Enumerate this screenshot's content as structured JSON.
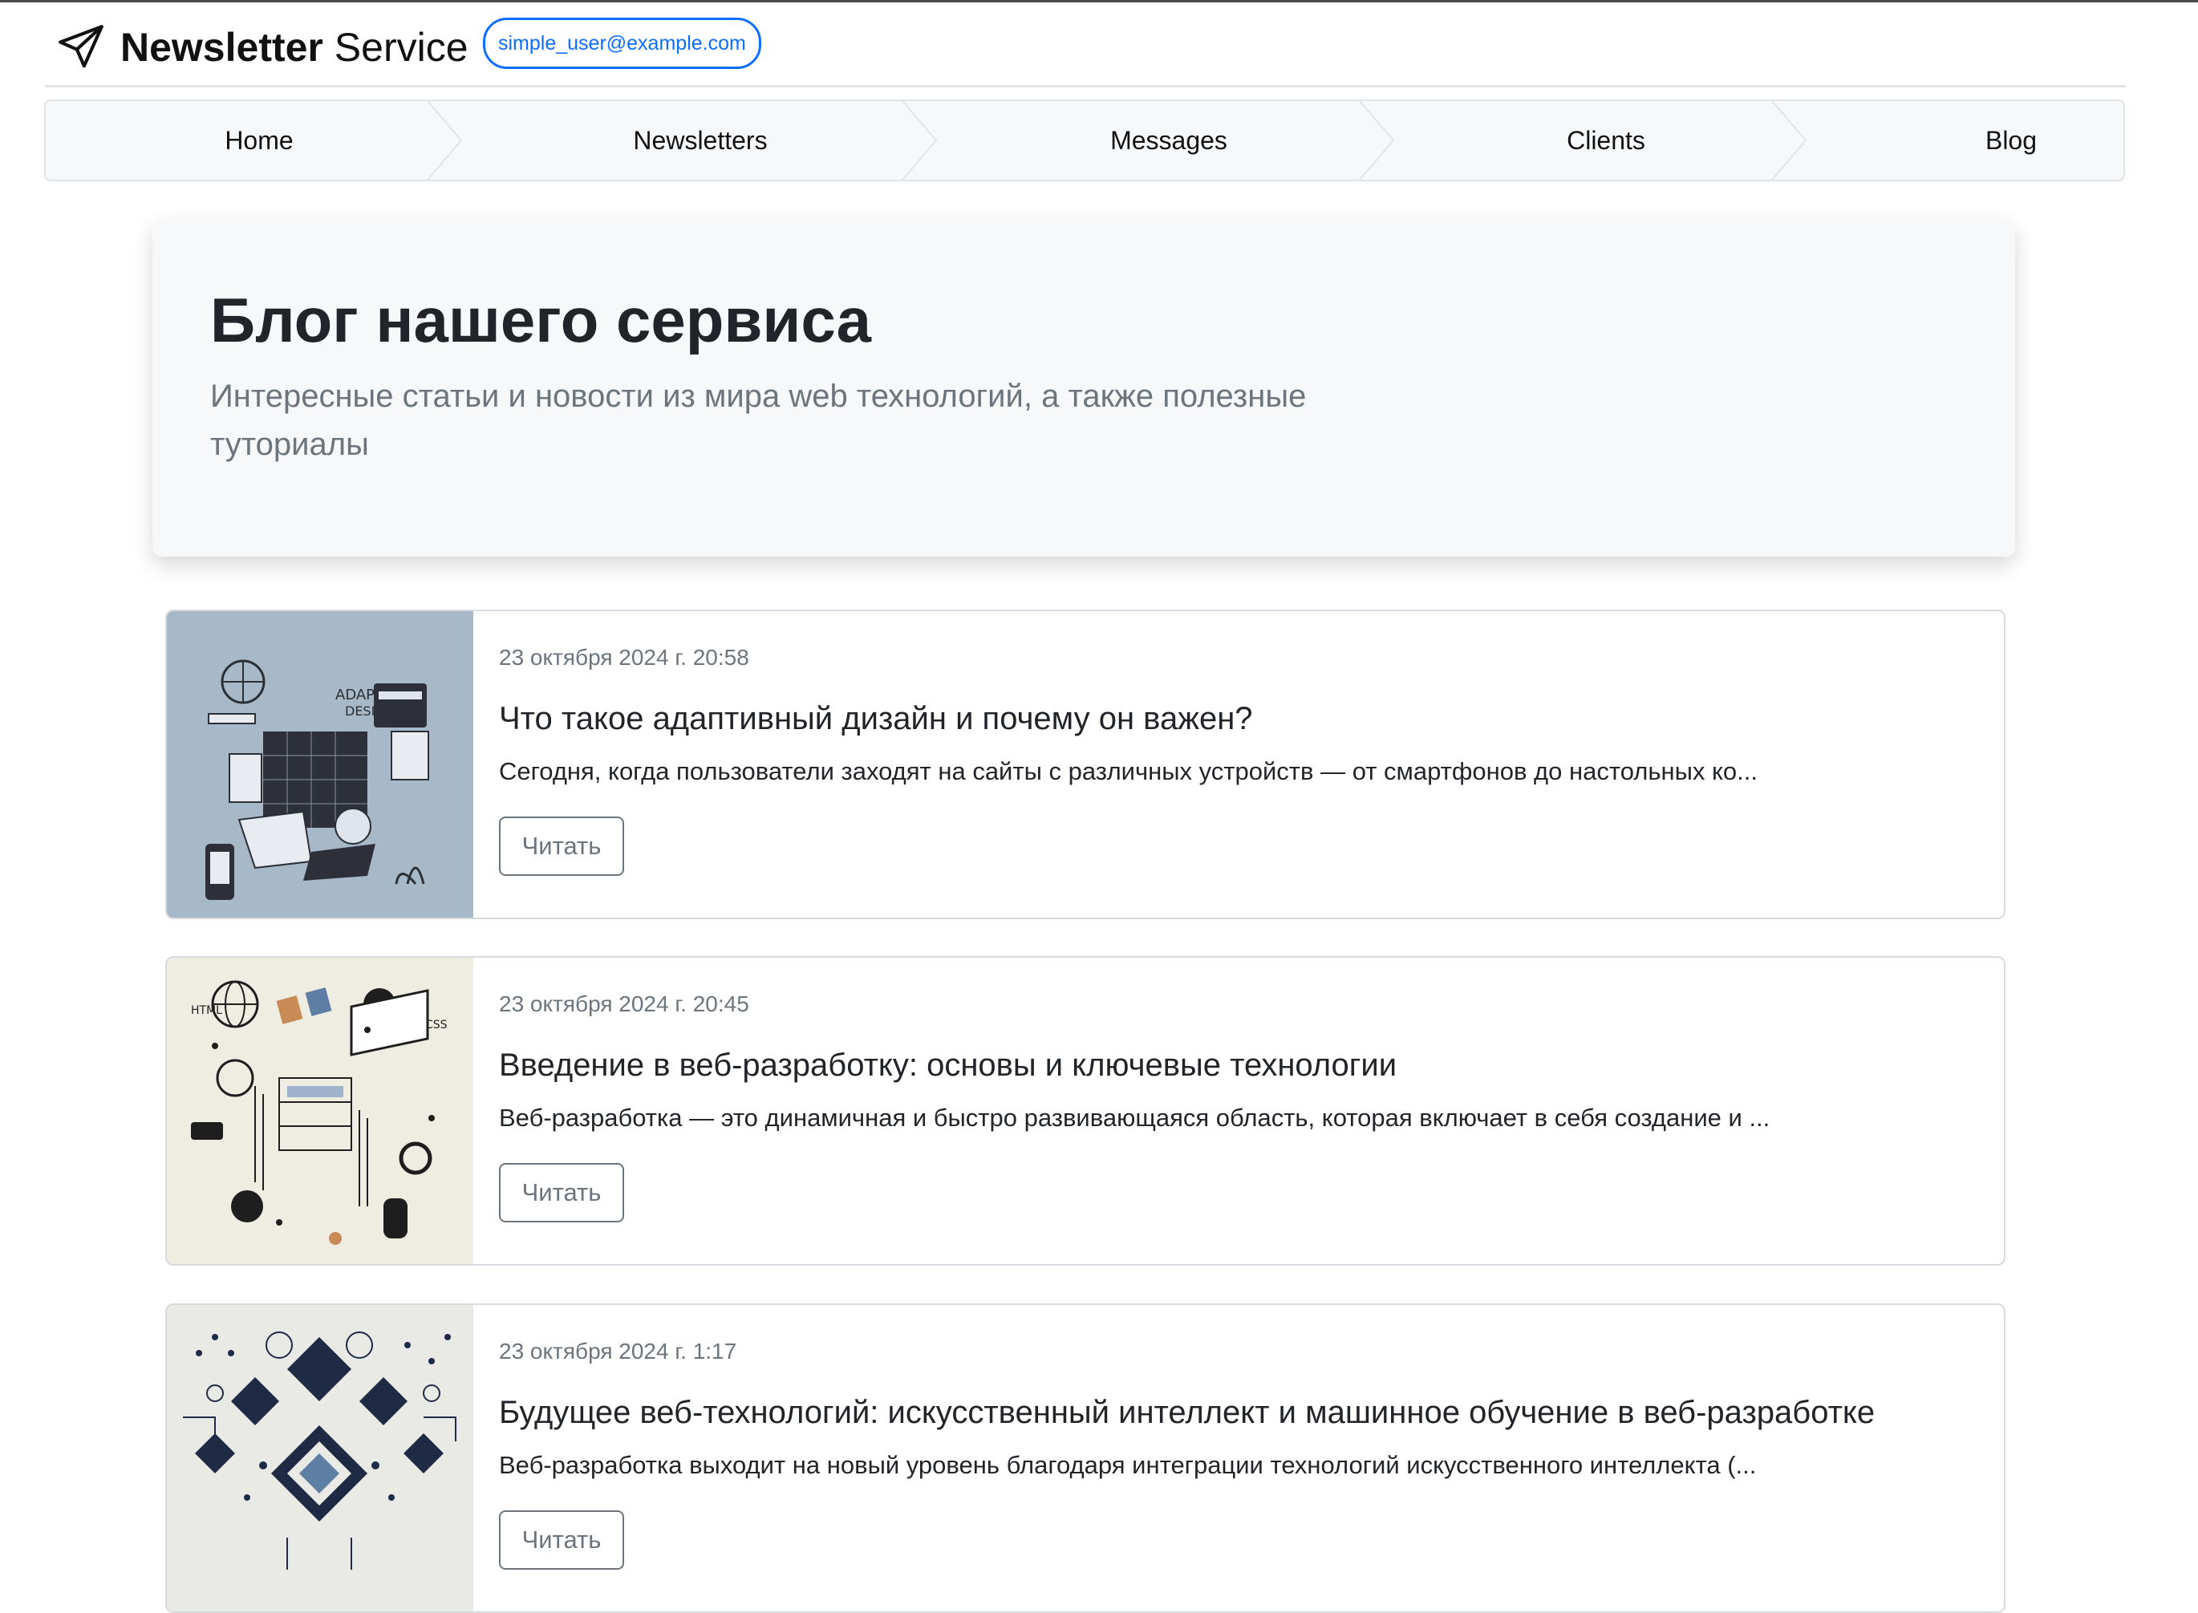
{
  "header": {
    "brand_bold": "Newsletter",
    "brand_rest": " Service",
    "user_email": "simple_user@example.com"
  },
  "nav": {
    "items": [
      "Home",
      "Newsletters",
      "Messages",
      "Clients",
      "Blog"
    ]
  },
  "jumbotron": {
    "title": "Блог нашего сервиса",
    "subtitle": "Интересные статьи и новости из мира web технологий, а также полезные туториалы"
  },
  "posts": [
    {
      "date": "23 октября 2024 г. 20:58",
      "title": "Что такое адаптивный дизайн и почему он важен?",
      "excerpt": "Сегодня, когда пользователи заходят на сайты с различных устройств — от смартфонов до настольных ко...",
      "button": "Читать",
      "thumb_bg": "#a7b8c8",
      "thumb_text_1": "ADAPTIVE",
      "thumb_text_2": "DESIGN"
    },
    {
      "date": "23 октября 2024 г. 20:45",
      "title": "Введение в веб-разработку: основы и ключевые технологии",
      "excerpt": "Веб-разработка — это динамичная и быстро развивающаяся область, которая включает в себя создание и ...",
      "button": "Читать",
      "thumb_bg": "#efece2",
      "thumb_text_1": "HTML",
      "thumb_text_2": "CSS"
    },
    {
      "date": "23 октября 2024 г. 1:17",
      "title": "Будущее веб-технологий: искусственный интеллект и машинное обучение в веб-разработке",
      "excerpt": "Веб-разработка выходит на новый уровень благодаря интеграции технологий искусственного интеллекта (...",
      "button": "Читать",
      "thumb_bg": "#e9e9e6"
    }
  ],
  "colors": {
    "accent": "#0d6efd",
    "muted": "#6c757d",
    "nav_bg": "#f7f8fa"
  }
}
